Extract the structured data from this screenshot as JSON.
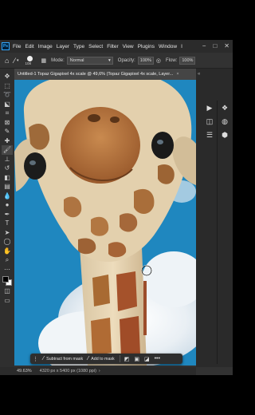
{
  "app": {
    "logo": "Ps",
    "menu": [
      "File",
      "Edit",
      "Image",
      "Layer",
      "Type",
      "Select",
      "Filter",
      "View",
      "Plugins",
      "Window",
      "I"
    ],
    "window_controls": [
      "−",
      "□",
      "✕"
    ]
  },
  "options": {
    "brush_size": "108",
    "mode_label": "Mode:",
    "mode_value": "Normal",
    "opacity_label": "Opacity:",
    "opacity_value": "100%",
    "flow_label": "Flow:",
    "flow_value": "100%"
  },
  "document": {
    "tab_title": "Untitled-1 Topaz Gigapixel 4x scale @ 49,6% (Topaz Gigapixel 4x scale, Layer...",
    "close": "×"
  },
  "context_bar": {
    "subtract_label": "Subtract from mask",
    "add_label": "Add to mask",
    "more": "•••"
  },
  "status": {
    "zoom": "49.63%",
    "doc_info": "4320 px x 5400 px (1080 ppi)",
    "arrow": "›"
  },
  "colors": {
    "accent": "#31a8ff",
    "sky": "#1f87bf",
    "foreground": "#000000",
    "background": "#ffffff"
  }
}
